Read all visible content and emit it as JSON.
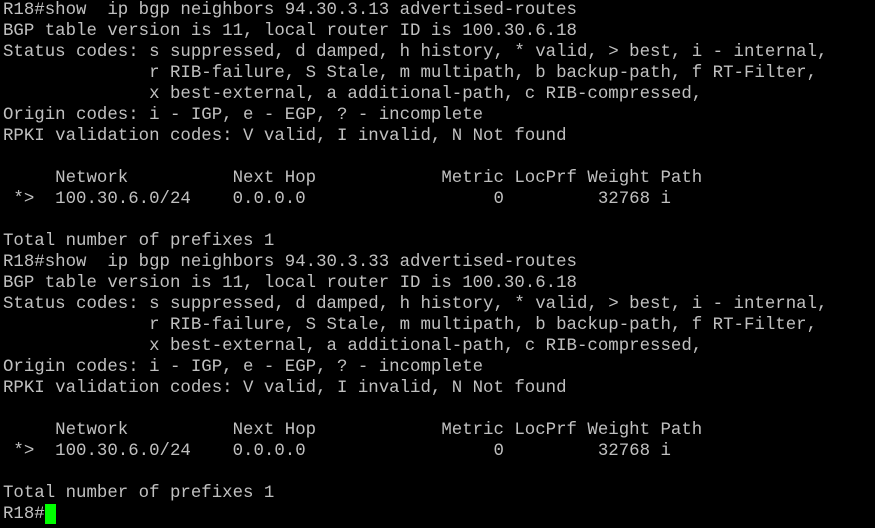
{
  "terminal": {
    "colors": {
      "background": "#000000",
      "foreground": "#c0c0c0",
      "cursor": "#00ff00"
    },
    "lines": [
      "R18#show  ip bgp neighbors 94.30.3.13 advertised-routes",
      "BGP table version is 11, local router ID is 100.30.6.18",
      "Status codes: s suppressed, d damped, h history, * valid, > best, i - internal,",
      "              r RIB-failure, S Stale, m multipath, b backup-path, f RT-Filter,",
      "              x best-external, a additional-path, c RIB-compressed,",
      "Origin codes: i - IGP, e - EGP, ? - incomplete",
      "RPKI validation codes: V valid, I invalid, N Not found",
      "",
      "     Network          Next Hop            Metric LocPrf Weight Path",
      " *>  100.30.6.0/24    0.0.0.0                  0         32768 i",
      "",
      "Total number of prefixes 1",
      "R18#show  ip bgp neighbors 94.30.3.33 advertised-routes",
      "BGP table version is 11, local router ID is 100.30.6.18",
      "Status codes: s suppressed, d damped, h history, * valid, > best, i - internal,",
      "              r RIB-failure, S Stale, m multipath, b backup-path, f RT-Filter,",
      "              x best-external, a additional-path, c RIB-compressed,",
      "Origin codes: i - IGP, e - EGP, ? - incomplete",
      "RPKI validation codes: V valid, I invalid, N Not found",
      "",
      "     Network          Next Hop            Metric LocPrf Weight Path",
      " *>  100.30.6.0/24    0.0.0.0                  0         32768 i",
      "",
      "Total number of prefixes 1"
    ],
    "prompt": "R18#"
  }
}
